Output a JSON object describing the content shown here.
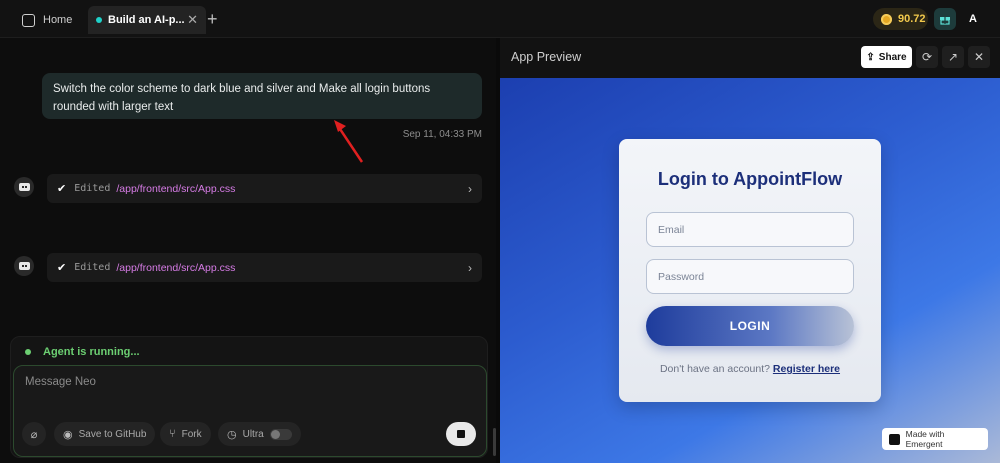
{
  "tabs": [
    {
      "label": "Home"
    },
    {
      "label": "Build an AI-p..."
    }
  ],
  "topbar": {
    "credits": "90.72",
    "avatar_letter": "A",
    "gift_icon": "gift-icon"
  },
  "chat": {
    "user_message": "Switch the color scheme to dark blue and silver and Make all login buttons rounded with larger text",
    "timestamp": "Sep 11, 04:33 PM",
    "edits": [
      {
        "action": "Edited",
        "path": "/app/frontend/src/App.css"
      },
      {
        "action": "Edited",
        "path": "/app/frontend/src/App.css"
      }
    ]
  },
  "composer": {
    "status": "Agent is running...",
    "placeholder": "Message Neo",
    "github_label": "Save to GitHub",
    "fork_label": "Fork",
    "ultra_label": "Ultra"
  },
  "preview": {
    "title": "App Preview",
    "share_label": "Share",
    "card_title": "Login to AppointFlow",
    "email_placeholder": "Email",
    "password_placeholder": "Password",
    "login_label": "LOGIN",
    "foot_text": "Don't have an account?",
    "register_label": "Register here",
    "made_with": "Made with Emergent"
  },
  "colors": {
    "accent_teal": "#1fd1c9",
    "running_green": "#6ccf72",
    "path_pink": "#d77ce6",
    "card_title_blue": "#1c2f7a"
  }
}
